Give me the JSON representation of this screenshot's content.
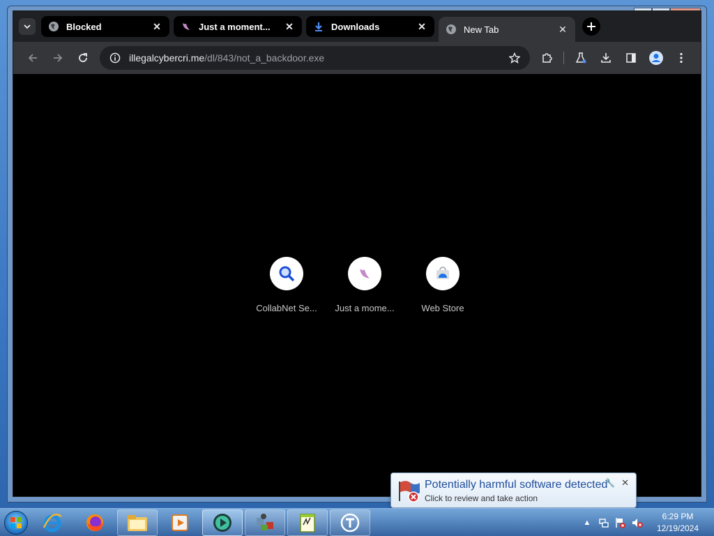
{
  "browser": {
    "tabs": [
      {
        "title": "Blocked",
        "favicon": "globe-icon"
      },
      {
        "title": "Just a moment...",
        "favicon": "horn-icon"
      },
      {
        "title": "Downloads",
        "favicon": "download-icon"
      },
      {
        "title": "New Tab",
        "favicon": "globe-icon",
        "active": true
      }
    ],
    "url_host": "illegalcybercri.me",
    "url_path": "/dl/843/not_a_backdoor.exe",
    "shortcuts": [
      {
        "label": "CollabNet Se...",
        "icon": "search-magnifier-icon"
      },
      {
        "label": "Just a mome...",
        "icon": "horn-icon"
      },
      {
        "label": "Web Store",
        "icon": "web-store-icon"
      }
    ]
  },
  "notification": {
    "title": "Potentially harmful software detected",
    "subtitle": "Click to review and take action"
  },
  "clock": {
    "time": "6:29 PM",
    "date": "12/19/2024"
  },
  "colors": {
    "tab_strip": "#1f2023",
    "toolbar": "#35363a",
    "notification_title": "#1f4d9b"
  }
}
